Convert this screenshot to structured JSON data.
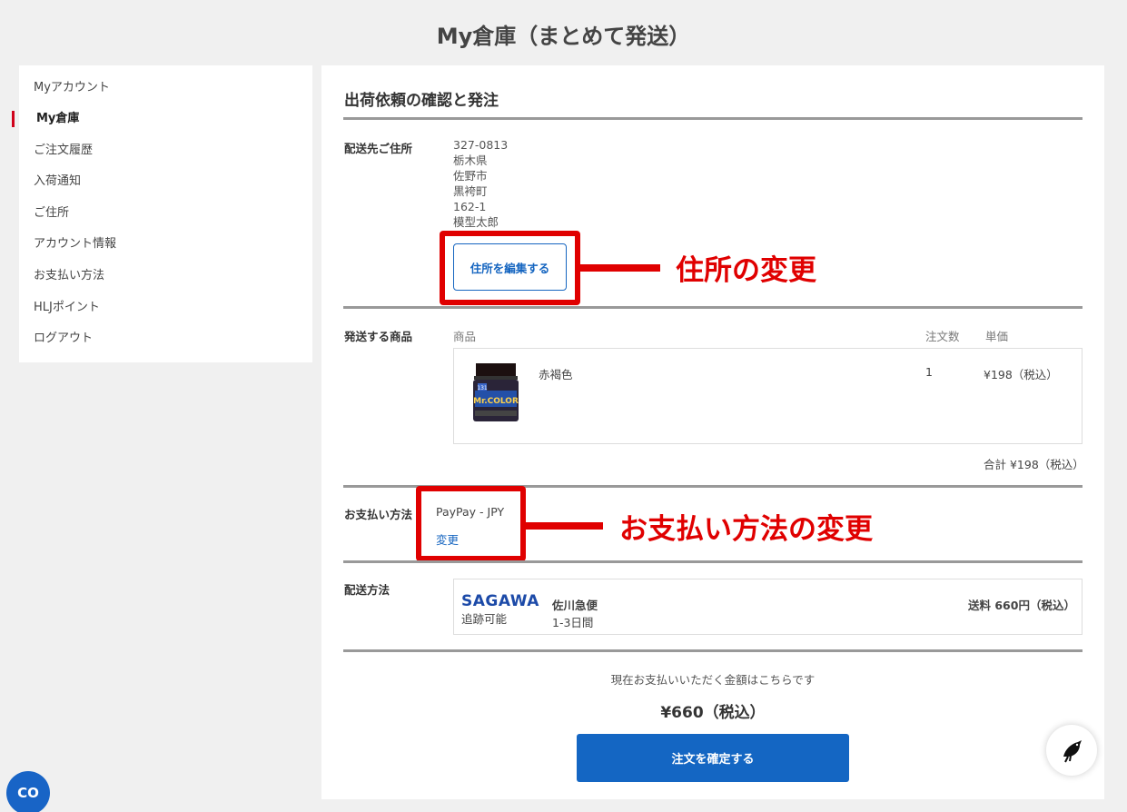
{
  "page_title": "My倉庫（まとめて発送）",
  "sidebar": {
    "items": [
      {
        "label": "Myアカウント"
      },
      {
        "label": "My倉庫"
      },
      {
        "label": "ご注文履歴"
      },
      {
        "label": "入荷通知"
      },
      {
        "label": "ご住所"
      },
      {
        "label": "アカウント情報"
      },
      {
        "label": "お支払い方法"
      },
      {
        "label": "HLJポイント"
      },
      {
        "label": "ログアウト"
      }
    ],
    "active_index": 1
  },
  "main": {
    "section_title": "出荷依頼の確認と発注",
    "address": {
      "label": "配送先ご住所",
      "lines": [
        "327-0813",
        "栃木県",
        "佐野市",
        "黒袴町",
        "162-1",
        "模型太郎"
      ],
      "edit_button": "住所を編集する",
      "annotation": "住所の変更"
    },
    "items": {
      "label": "発送する商品",
      "col_product": "商品",
      "col_qty": "注文数",
      "col_price": "単価",
      "rows": [
        {
          "name": "赤褐色",
          "qty": "1",
          "price": "¥198（税込）",
          "thumb_icon": "paint-bottle-icon"
        }
      ],
      "total": "合計 ¥198（税込）"
    },
    "payment": {
      "label": "お支払い方法",
      "method": "PayPay - JPY",
      "change_link": "変更",
      "annotation": "お支払い方法の変更"
    },
    "shipping": {
      "label": "配送方法",
      "carrier_logo": "SAGAWA",
      "tracking": "追跡可能",
      "carrier_name": "佐川急便",
      "days": "1-3日間",
      "fee": "送料 660円（税込）"
    },
    "summary": {
      "note": "現在お支払いいただく金額はこちらです",
      "amount": "¥660（税込）",
      "confirm_button": "注文を確定する"
    }
  },
  "fabs": {
    "chat_icon": "bird-chat-icon",
    "co_label": "CO"
  },
  "colors": {
    "accent_blue": "#1466c3",
    "annotation_red": "#e00000",
    "active_marker": "#d0021b"
  }
}
